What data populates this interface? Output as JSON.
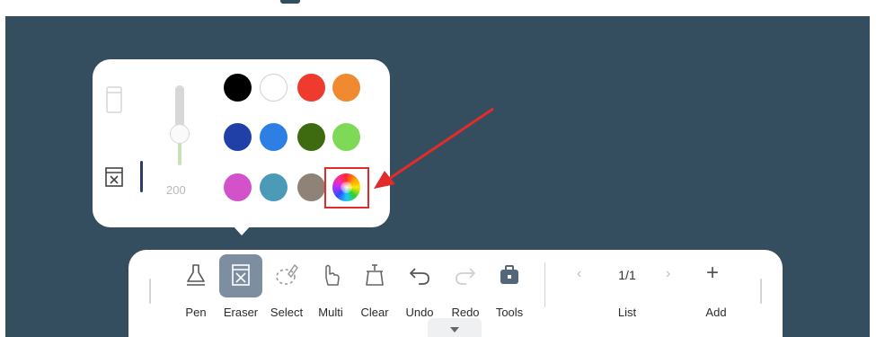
{
  "popup": {
    "stroke_size": "200",
    "colors": [
      {
        "name": "black",
        "hex": "#000000"
      },
      {
        "name": "white",
        "hex": "#ffffff"
      },
      {
        "name": "red",
        "hex": "#ee3b2e"
      },
      {
        "name": "orange",
        "hex": "#ef8a30"
      },
      {
        "name": "navy",
        "hex": "#2040a8"
      },
      {
        "name": "blue",
        "hex": "#2d7fe3"
      },
      {
        "name": "dark-green",
        "hex": "#3f6b10"
      },
      {
        "name": "light-green",
        "hex": "#7ed957"
      },
      {
        "name": "magenta",
        "hex": "#d352c9"
      },
      {
        "name": "teal",
        "hex": "#4a9ab8"
      },
      {
        "name": "taupe",
        "hex": "#8f8378"
      }
    ],
    "custom_color_icon": "color-wheel-icon",
    "highlight_color": "#e22b2b"
  },
  "toolbar": {
    "tools": [
      {
        "id": "pen",
        "label": "Pen",
        "icon": "pen-icon"
      },
      {
        "id": "eraser",
        "label": "Eraser",
        "icon": "eraser-icon",
        "active": true
      },
      {
        "id": "select",
        "label": "Select",
        "icon": "lasso-icon"
      },
      {
        "id": "multi",
        "label": "Multi",
        "icon": "multi-touch-icon"
      },
      {
        "id": "clear",
        "label": "Clear",
        "icon": "clear-icon"
      },
      {
        "id": "undo",
        "label": "Undo",
        "icon": "undo-icon"
      },
      {
        "id": "redo",
        "label": "Redo",
        "icon": "redo-icon"
      },
      {
        "id": "tools",
        "label": "Tools",
        "icon": "toolbox-icon"
      }
    ],
    "page": {
      "indicator": "1/1",
      "list_label": "List",
      "add_label": "Add",
      "prev_icon": "chevron-left-icon",
      "next_icon": "chevron-right-icon"
    }
  },
  "colors": {
    "canvas_bg": "#354e5f",
    "active_tool_bg": "#7d8ea1",
    "arrow": "#e22b2b"
  }
}
